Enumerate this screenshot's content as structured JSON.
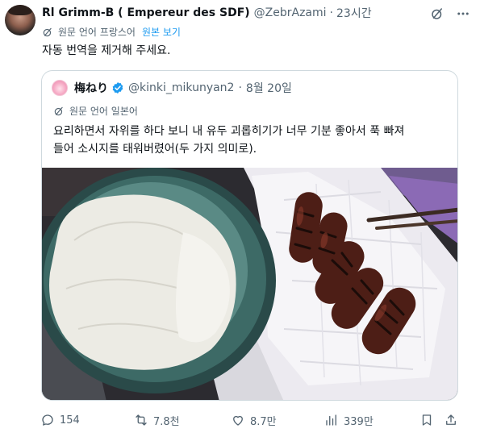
{
  "author": {
    "display_name": "Rl Grimm-B ( Empereur des SDF)",
    "handle": "@ZebrAzami",
    "separator": "·",
    "time": "23시간"
  },
  "translation": {
    "notice": "원문 언어 프랑스어",
    "show_original": "원본 보기"
  },
  "tweet_text": "자동 번역을 제거해 주세요.",
  "quoted": {
    "display_name": "梅ねり",
    "handle": "@kinki_mikunyan2",
    "separator": "·",
    "date": "8월 20일",
    "translation_notice": "원문 언어 일본어",
    "text_line1": "요리하면서 자위를 하다 보니 내 유두 괴롭히기가 너무 기분 좋아서 푹 빠져",
    "text_line2": "들어 소시지를 태워버렸어(두 가지 의미로)."
  },
  "actions": {
    "replies": "154",
    "reposts": "7.8천",
    "likes": "8.7만",
    "views": "339만"
  },
  "icons": {
    "grok": "grok-icon",
    "more": "more-icon",
    "translate": "translate-icon",
    "verified": "verified-badge-icon",
    "reply": "reply-icon",
    "repost": "repost-icon",
    "like": "like-icon",
    "views": "views-icon",
    "bookmark": "bookmark-icon",
    "share": "share-icon"
  },
  "colors": {
    "accent": "#1d9bf0",
    "secondary_text": "#536471",
    "border": "#cfd9de"
  }
}
